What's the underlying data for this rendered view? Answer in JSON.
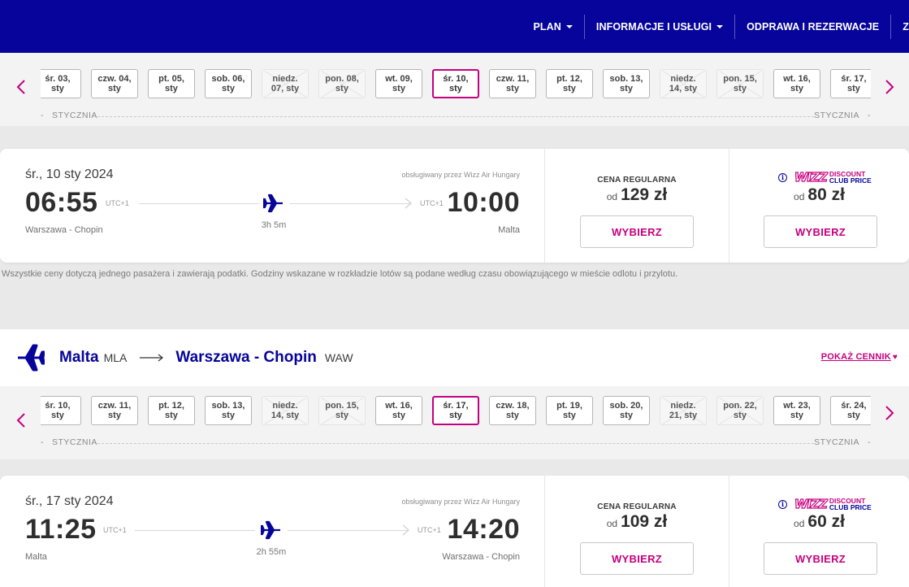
{
  "nav": {
    "items": [
      {
        "label": "PLAN",
        "dropdown": true
      },
      {
        "label": "INFORMACJE I USŁUGI",
        "dropdown": true
      },
      {
        "label": "ODPRAWA I REZERWACJE",
        "dropdown": false
      },
      {
        "label": "Z",
        "dropdown": false
      }
    ]
  },
  "outbound": {
    "dates": [
      {
        "label": "śr. 03,\nsty",
        "available": true,
        "selected": false
      },
      {
        "label": "czw. 04,\nsty",
        "available": true,
        "selected": false
      },
      {
        "label": "pt. 05,\nsty",
        "available": true,
        "selected": false
      },
      {
        "label": "sob. 06,\nsty",
        "available": true,
        "selected": false
      },
      {
        "label": "niedz.\n07, sty",
        "available": false,
        "selected": false
      },
      {
        "label": "pon. 08,\nsty",
        "available": false,
        "selected": false
      },
      {
        "label": "wt. 09,\nsty",
        "available": true,
        "selected": false
      },
      {
        "label": "śr. 10,\nsty",
        "available": true,
        "selected": true
      },
      {
        "label": "czw. 11,\nsty",
        "available": true,
        "selected": false
      },
      {
        "label": "pt. 12,\nsty",
        "available": true,
        "selected": false
      },
      {
        "label": "sob. 13,\nsty",
        "available": true,
        "selected": false
      },
      {
        "label": "niedz.\n14, sty",
        "available": false,
        "selected": false
      },
      {
        "label": "pon. 15,\nsty",
        "available": false,
        "selected": false
      },
      {
        "label": "wt. 16,\nsty",
        "available": true,
        "selected": false
      },
      {
        "label": "śr. 17,\nsty",
        "available": true,
        "selected": false
      }
    ],
    "month_left": "STYCZNIA",
    "month_right": "STYCZNIA",
    "flight": {
      "date": "śr., 10 sty 2024",
      "operated_by": "obsługiwany przez Wizz Air Hungary",
      "dep_time": "06:55",
      "dep_utc": "UTC+1",
      "arr_time": "10:00",
      "arr_utc": "UTC+1",
      "duration": "3h 5m",
      "from": "Warszawa - Chopin",
      "to": "Malta",
      "regular_label": "CENA REGULARNA",
      "od": "od",
      "regular_price": "129 zł",
      "club_price": "80 zł",
      "select_label": "WYBIERZ"
    }
  },
  "disclaimer": "Wszystkie ceny dotyczą jednego pasażera i zawierają podatki. Godziny wskazane w rozkładzie lotów są podane według czasu obowiązującego w mieście odlotu i przylotu.",
  "discount_club": {
    "wizz": "WIZZ",
    "line1": "DISCOUNT",
    "line2": "CLUB PRICE"
  },
  "return_route": {
    "from_city": "Malta",
    "from_code": "MLA",
    "to_city": "Warszawa - Chopin",
    "to_code": "WAW",
    "show_prices": "POKAŻ CENNIK"
  },
  "inbound": {
    "dates": [
      {
        "label": "śr. 10,\nsty",
        "available": true,
        "selected": false
      },
      {
        "label": "czw. 11,\nsty",
        "available": true,
        "selected": false
      },
      {
        "label": "pt. 12,\nsty",
        "available": true,
        "selected": false
      },
      {
        "label": "sob. 13,\nsty",
        "available": true,
        "selected": false
      },
      {
        "label": "niedz.\n14, sty",
        "available": false,
        "selected": false
      },
      {
        "label": "pon. 15,\nsty",
        "available": false,
        "selected": false
      },
      {
        "label": "wt. 16,\nsty",
        "available": true,
        "selected": false
      },
      {
        "label": "śr. 17,\nsty",
        "available": true,
        "selected": true
      },
      {
        "label": "czw. 18,\nsty",
        "available": true,
        "selected": false
      },
      {
        "label": "pt. 19,\nsty",
        "available": true,
        "selected": false
      },
      {
        "label": "sob. 20,\nsty",
        "available": true,
        "selected": false
      },
      {
        "label": "niedz.\n21, sty",
        "available": false,
        "selected": false
      },
      {
        "label": "pon. 22,\nsty",
        "available": false,
        "selected": false
      },
      {
        "label": "wt. 23,\nsty",
        "available": true,
        "selected": false
      },
      {
        "label": "śr. 24,\nsty",
        "available": true,
        "selected": false
      }
    ],
    "month_left": "STYCZNIA",
    "month_right": "STYCZNIA",
    "flight": {
      "date": "śr., 17 sty 2024",
      "operated_by": "obsługiwany przez Wizz Air Hungary",
      "dep_time": "11:25",
      "dep_utc": "UTC+1",
      "arr_time": "14:20",
      "arr_utc": "UTC+1",
      "duration": "2h 55m",
      "from": "Malta",
      "to": "Warszawa - Chopin",
      "regular_label": "CENA REGULARNA",
      "od": "od",
      "regular_price": "109 zł",
      "club_price": "60 zł",
      "select_label": "WYBIERZ"
    }
  },
  "colors": {
    "brand_blue": "#06049a",
    "brand_pink": "#c6007e"
  }
}
